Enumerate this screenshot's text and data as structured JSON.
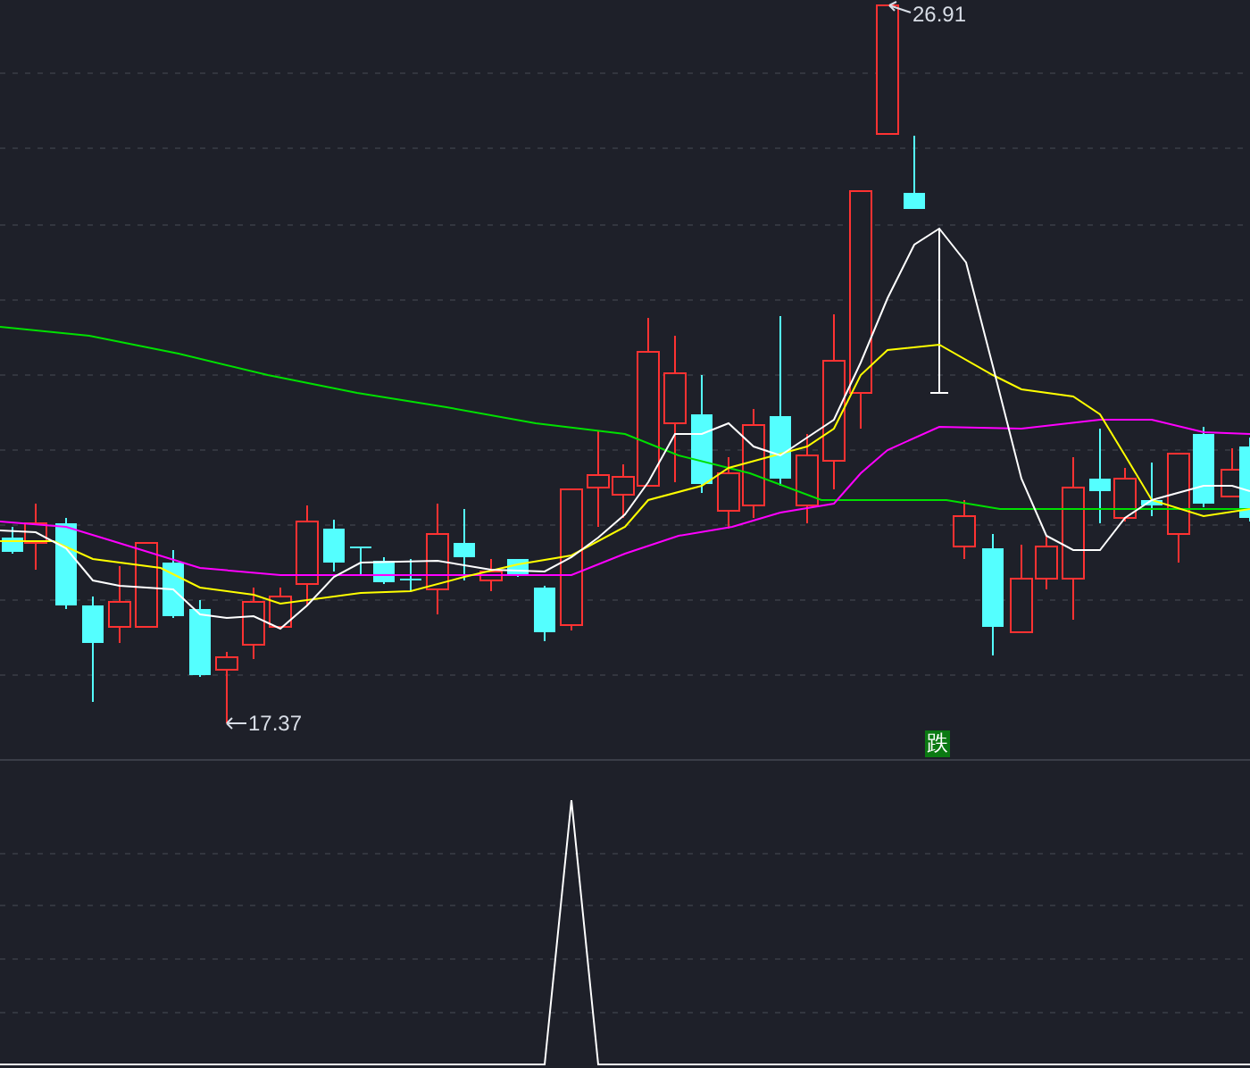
{
  "price_chart": {
    "high_marker": "26.91",
    "low_marker": "17.37",
    "signal_badge": "跌"
  }
}
